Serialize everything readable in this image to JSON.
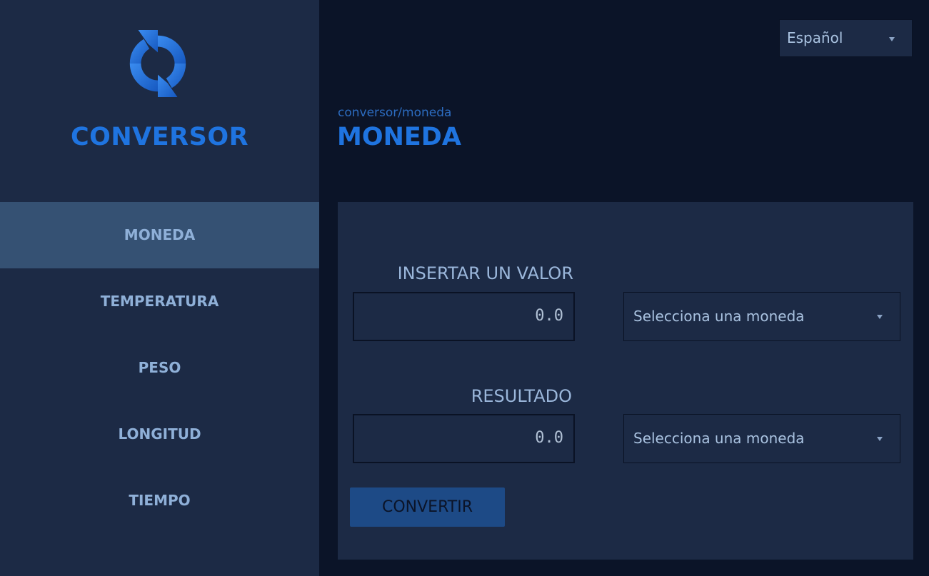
{
  "sidebar": {
    "brand": "CONVERSOR",
    "logo_icon": "refresh-arrows-icon",
    "items": [
      {
        "label": "MONEDA",
        "active": true
      },
      {
        "label": "TEMPERATURA",
        "active": false
      },
      {
        "label": "PESO",
        "active": false
      },
      {
        "label": "LONGITUD",
        "active": false
      },
      {
        "label": "TIEMPO",
        "active": false
      }
    ]
  },
  "language": {
    "selected": "Español"
  },
  "header": {
    "breadcrumb": "conversor/moneda",
    "title": "MONEDA"
  },
  "form": {
    "input_label": "INSERTAR UN VALOR",
    "input_value": "0.0",
    "input_currency_placeholder": "Selecciona una moneda",
    "result_label": "RESULTADO",
    "result_value": "0.0",
    "result_currency_placeholder": "Selecciona una moneda",
    "convert_label": "CONVERTIR"
  },
  "colors": {
    "background": "#0b1428",
    "sidebar": "#1c2a45",
    "accent": "#1f74e0",
    "active_item": "#355173",
    "button": "#1d4a86"
  }
}
